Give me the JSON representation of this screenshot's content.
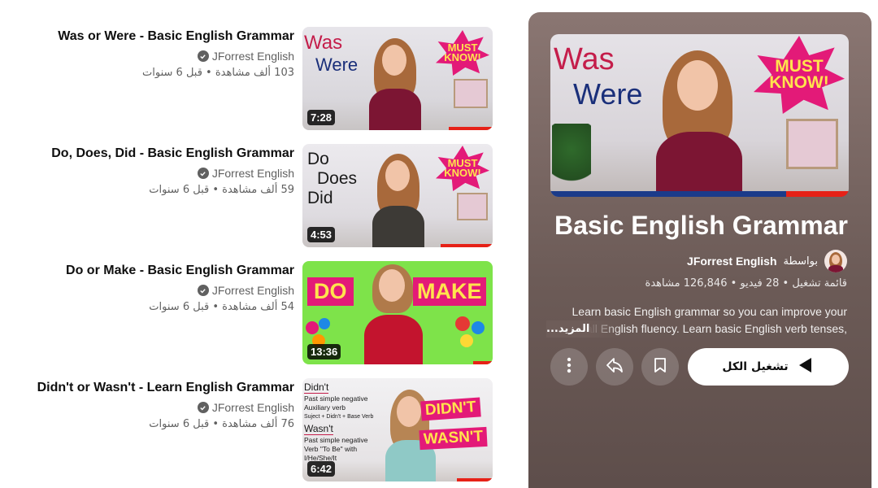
{
  "videos": [
    {
      "title": "Was or Were - Basic English Grammar",
      "channel": "JForrest English",
      "stats": "103 ألف مشاهدة • قبل 6 سنوات",
      "duration": "7:28",
      "thumb_words": [
        "Was",
        "Were"
      ],
      "badge": [
        "MUST",
        "KNOW!"
      ]
    },
    {
      "title": "Do, Does, Did - Basic English Grammar",
      "channel": "JForrest English",
      "stats": "59 ألف مشاهدة • قبل 6 سنوات",
      "duration": "4:53",
      "thumb_words": [
        "Do",
        "Does",
        "Did"
      ],
      "badge": [
        "MUST",
        "KNOW!"
      ]
    },
    {
      "title": "Do or Make - Basic English Grammar",
      "channel": "JForrest English",
      "stats": "54 ألف مشاهدة • قبل 6 سنوات",
      "duration": "13:36",
      "thumb_words": [
        "DO",
        "MAKE"
      ]
    },
    {
      "title": "Didn't or Wasn't - Learn English Grammar",
      "channel": "JForrest English",
      "stats": "76 ألف مشاهدة • قبل 6 سنوات",
      "duration": "6:42",
      "thumb_words": [
        "Didn't",
        "Past simple negative",
        "Auxiliary verb",
        "Suject + Didn't + Base Verb",
        "Wasn't",
        "Past simple negative",
        "Verb \"To Be\" with",
        "I/He/She/It",
        "DIDN'T",
        "WASN'T"
      ]
    }
  ],
  "playlist": {
    "thumb_words": [
      "Was",
      "Were"
    ],
    "badge": [
      "MUST",
      "KNOW!"
    ],
    "title": "Basic English Grammar",
    "by_label": "بواسطة",
    "owner": "JForrest English",
    "stats": "قائمة تشغيل • 28 فيديو • 126,846 مشاهدة",
    "description_line1": "Learn basic English grammar so you can improve your",
    "description_line2": "overall English fluency. Learn basic English verb tenses,",
    "more_label": "...المزيد",
    "play_all_label": "تشغيل الكل"
  },
  "icons": {
    "verified": "verified-check-icon",
    "play": "play-icon",
    "save": "save-bookmark-icon",
    "share": "share-icon",
    "more": "more-vertical-icon"
  },
  "colors": {
    "badge_pink": "#e31a78",
    "badge_yellow": "#ffe44d",
    "duration_bg": "#000000",
    "panel_bg": "#6c5b57",
    "progress_red": "#e62117"
  }
}
